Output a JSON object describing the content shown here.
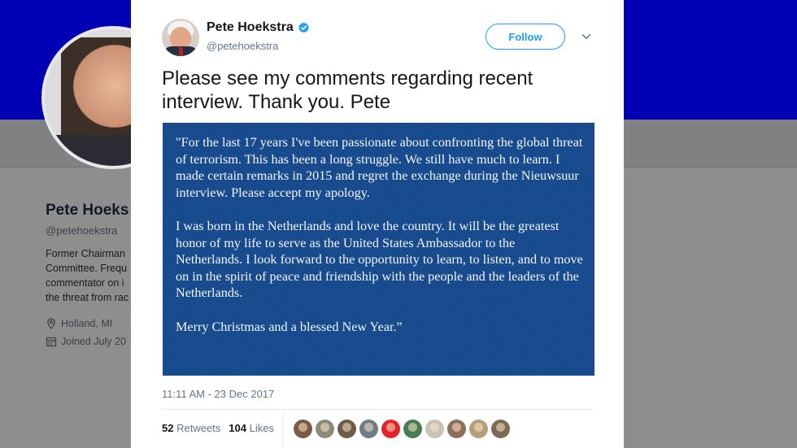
{
  "background_profile": {
    "name": "Pete Hoeks",
    "handle": "@petehoekstra",
    "bio_lines": [
      "Former Chairman",
      "Committee. Frequ",
      "commentator on i",
      "the threat from rac"
    ],
    "location": "Holland, MI",
    "joined": "Joined July 20"
  },
  "tweet": {
    "author_name": "Pete Hoekstra",
    "author_handle": "@petehoekstra",
    "verified": true,
    "follow_label": "Follow",
    "text": "Please see my comments regarding recent interview.  Thank you.  Pete",
    "image_paragraphs": [
      "\"For the last 17 years I've been passionate about confronting the global threat of terrorism.  This has been a long struggle.  We still have much to learn.  I made certain remarks in 2015 and regret the exchange during the Nieuwsuur interview.  Please accept my apology.",
      "I was born in the Netherlands and love the country.  It will be the greatest honor of my life to serve as the United States Ambassador to the Netherlands. I look forward to the opportunity to learn, to listen, and to move on in the spirit of peace and friendship with the people and the leaders of the Netherlands.",
      "Merry Christmas and a blessed New Year.”"
    ],
    "timestamp": "11:11 AM - 23 Dec 2017",
    "retweets_count": "52",
    "retweets_label": "Retweets",
    "likes_count": "104",
    "likes_label": "Likes",
    "liker_colors": [
      "#7a5b46",
      "#8b8b7a",
      "#6d5a48",
      "#6e7d86",
      "#e0252a",
      "#4b7d54",
      "#c8c2b8",
      "#8c6e5a",
      "#b59e7c",
      "#7b6a55"
    ]
  },
  "colors": {
    "banner": "#0202b4",
    "accent": "#1da1f2",
    "image_bg": "#164a8e"
  },
  "icons": [
    "verified-badge-icon",
    "chevron-down-icon",
    "location-pin-icon",
    "calendar-icon"
  ]
}
